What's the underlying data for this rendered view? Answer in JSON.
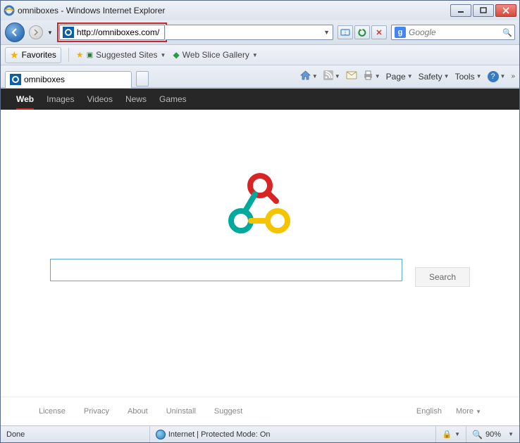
{
  "window": {
    "title": "omniboxes - Windows Internet Explorer"
  },
  "address": {
    "url": "http://omniboxes.com/"
  },
  "searchbox": {
    "provider": "g",
    "placeholder": "Google"
  },
  "favbar": {
    "favorites": "Favorites",
    "suggested": "Suggested Sites",
    "webslice": "Web Slice Gallery"
  },
  "tab": {
    "title": "omniboxes"
  },
  "commands": {
    "page": "Page",
    "safety": "Safety",
    "tools": "Tools"
  },
  "pagenav": {
    "web": "Web",
    "images": "Images",
    "videos": "Videos",
    "news": "News",
    "games": "Games"
  },
  "search": {
    "button": "Search"
  },
  "footer": {
    "license": "License",
    "privacy": "Privacy",
    "about": "About",
    "uninstall": "Uninstall",
    "suggest": "Suggest",
    "english": "English",
    "more": "More"
  },
  "status": {
    "done": "Done",
    "protected": "Internet | Protected Mode: On",
    "zoom": "90%"
  }
}
